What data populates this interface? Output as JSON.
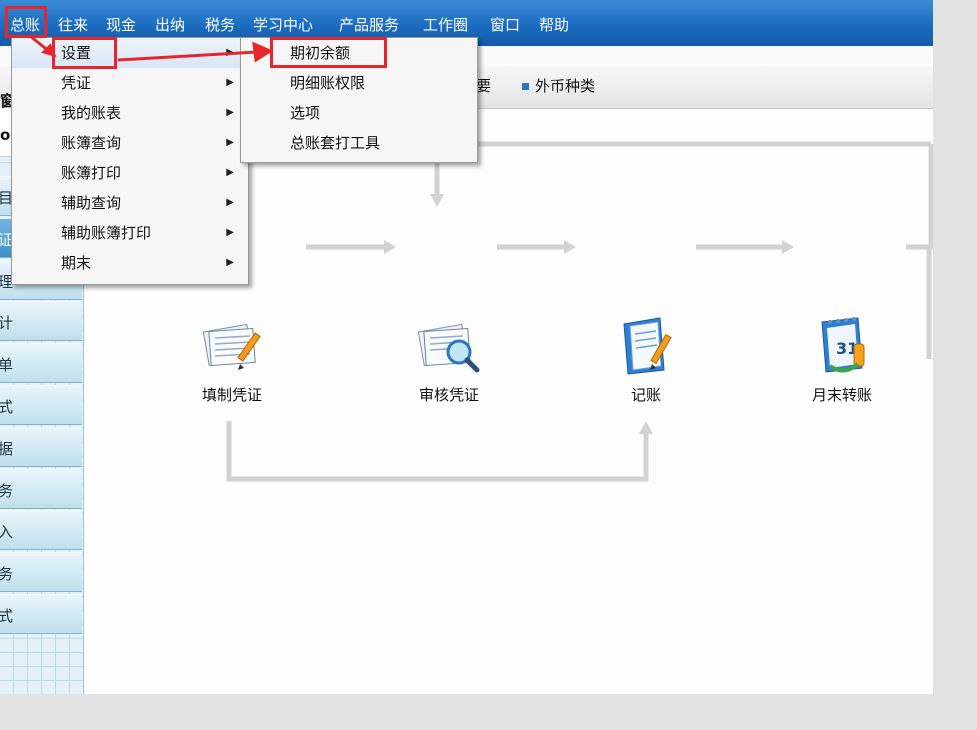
{
  "menubar": {
    "items": [
      "总账",
      "往来",
      "现金",
      "出纳",
      "税务",
      "学习中心",
      "产品服务",
      "工作圈",
      "窗口",
      "帮助"
    ]
  },
  "toolbar": {
    "partial_label": "要",
    "item": "外币种类"
  },
  "left_panel": {
    "top_chars": [
      "窗",
      "o"
    ],
    "row_chars": [
      "目",
      "证",
      "理",
      "计",
      "单",
      "式",
      "据",
      "务",
      "入",
      "务",
      "式"
    ]
  },
  "dropdown": {
    "items": [
      {
        "label": "设置",
        "has_submenu": true
      },
      {
        "label": "凭证",
        "has_submenu": true
      },
      {
        "label": "我的账表",
        "has_submenu": true
      },
      {
        "label": "账簿查询",
        "has_submenu": true
      },
      {
        "label": "账簿打印",
        "has_submenu": true
      },
      {
        "label": "辅助查询",
        "has_submenu": true
      },
      {
        "label": "辅助账簿打印",
        "has_submenu": true
      },
      {
        "label": "期末",
        "has_submenu": true
      }
    ],
    "arrow": "▶"
  },
  "submenu": {
    "items": [
      "期初余额",
      "明细账权限",
      "选项",
      "总账套打工具"
    ]
  },
  "flow": {
    "nodes": [
      {
        "label": "填制凭证",
        "icon": "voucher-pen-icon"
      },
      {
        "label": "审核凭证",
        "icon": "voucher-magnifier-icon"
      },
      {
        "label": "记账",
        "icon": "book-pen-icon"
      },
      {
        "label": "月末转账",
        "icon": "calendar-transfer-icon"
      }
    ],
    "calendar_text": "31"
  },
  "colors": {
    "menubar": "#1c6cc0",
    "highlight_box": "#e8262a",
    "flow_arrow": "#cfcfcf"
  }
}
